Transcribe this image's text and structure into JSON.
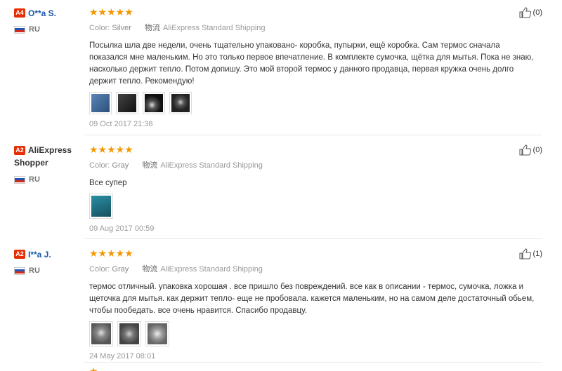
{
  "reviews": [
    {
      "level": "A4",
      "name": "O**a S.",
      "country": "RU",
      "stars": "★★★★★",
      "color_label": "Color:",
      "color_value": "Silver",
      "ship_icon": "物流",
      "shipping": "AliExpress Standard Shipping",
      "text": "Посылка шла две недели, очень тщательно упаковано- коробка, пупырки, ещё коробка. Сам термос сначала показался мне маленьким. Но это только первое впечатление. В комплекте сумочка, щётка для мытья. Пока не знаю, насколько держит тепло. Потом допишу. Это мой второй термос у данного продавца, первая кружка очень долго держит тепло. Рекомендую!",
      "date": "09 Oct 2017 21:38",
      "helpful": "(0)",
      "thumb_colors": [
        "#3a6ea8",
        "#2b2b2b",
        "#1e1e1e",
        "#333333"
      ]
    },
    {
      "level": "A2",
      "name": "AliExpress Shopper",
      "country": "RU",
      "stars": "★★★★★",
      "color_label": "Color:",
      "color_value": "Gray",
      "ship_icon": "物流",
      "shipping": "AliExpress Standard Shipping",
      "text": "Все супер",
      "date": "09 Aug 2017 00:59",
      "helpful": "(0)",
      "thumb_colors": [
        "#1f7a8c"
      ]
    },
    {
      "level": "A2",
      "name": "I**a J.",
      "country": "RU",
      "stars": "★★★★★",
      "color_label": "Color:",
      "color_value": "Gray",
      "ship_icon": "物流",
      "shipping": "AliExpress Standard Shipping",
      "text": "термос отличный. упаковка хорошая . все пришло без повреждений. все как в описании - термос, сумочка, ложка и щеточка для мытья. как держит тепло- еще не пробовала. кажется маленьким, но на самом деле достаточный обьем, чтобы пообедать. все очень нравится. Спасибо продавцу.",
      "date": "24 May 2017 08:01",
      "helpful": "(1)",
      "thumb_colors": [
        "#8a8f94",
        "#6d7378",
        "#9aa0a5"
      ]
    }
  ]
}
